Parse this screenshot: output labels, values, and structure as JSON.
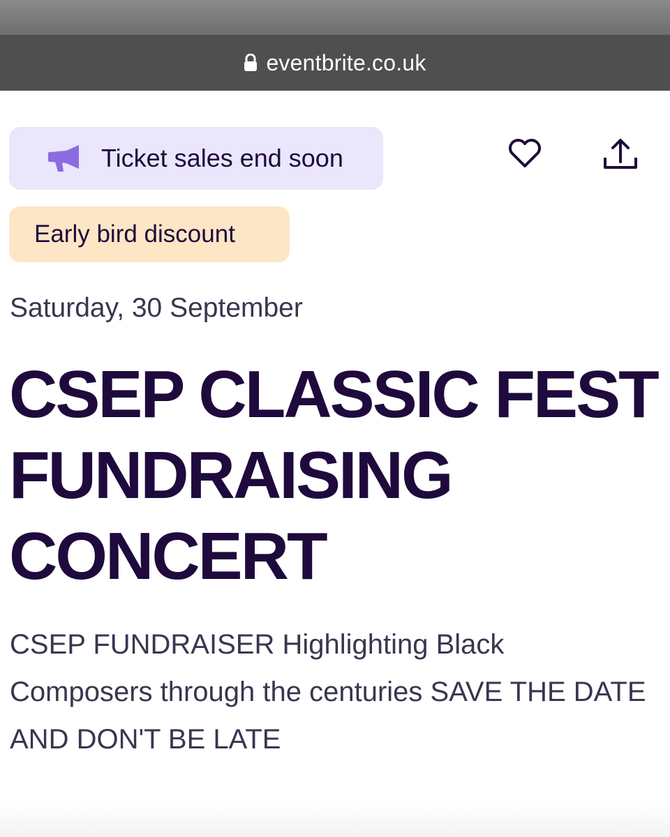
{
  "browser": {
    "url": "eventbrite.co.uk",
    "lock_icon": "lock-icon"
  },
  "badges": {
    "sales": {
      "icon": "megaphone-icon",
      "label": "Ticket sales end soon",
      "icon_color": "#8a6ce0",
      "background": "#eae6fb"
    },
    "discount": {
      "label": "Early bird discount",
      "background": "#fde6c6"
    }
  },
  "actions": {
    "like_icon": "heart-icon",
    "share_icon": "share-icon"
  },
  "event": {
    "date": "Saturday, 30 September",
    "title": "CSEP CLASSIC FEST FUNDRAISING CONCERT",
    "summary": "CSEP FUNDRAISER Highlighting Black Composers through the centuries SAVE THE DATE AND DON'T BE LATE"
  },
  "colors": {
    "text_primary": "#1e0a3c",
    "text_secondary": "#39364f",
    "url_bar": "#4f4f4f"
  }
}
